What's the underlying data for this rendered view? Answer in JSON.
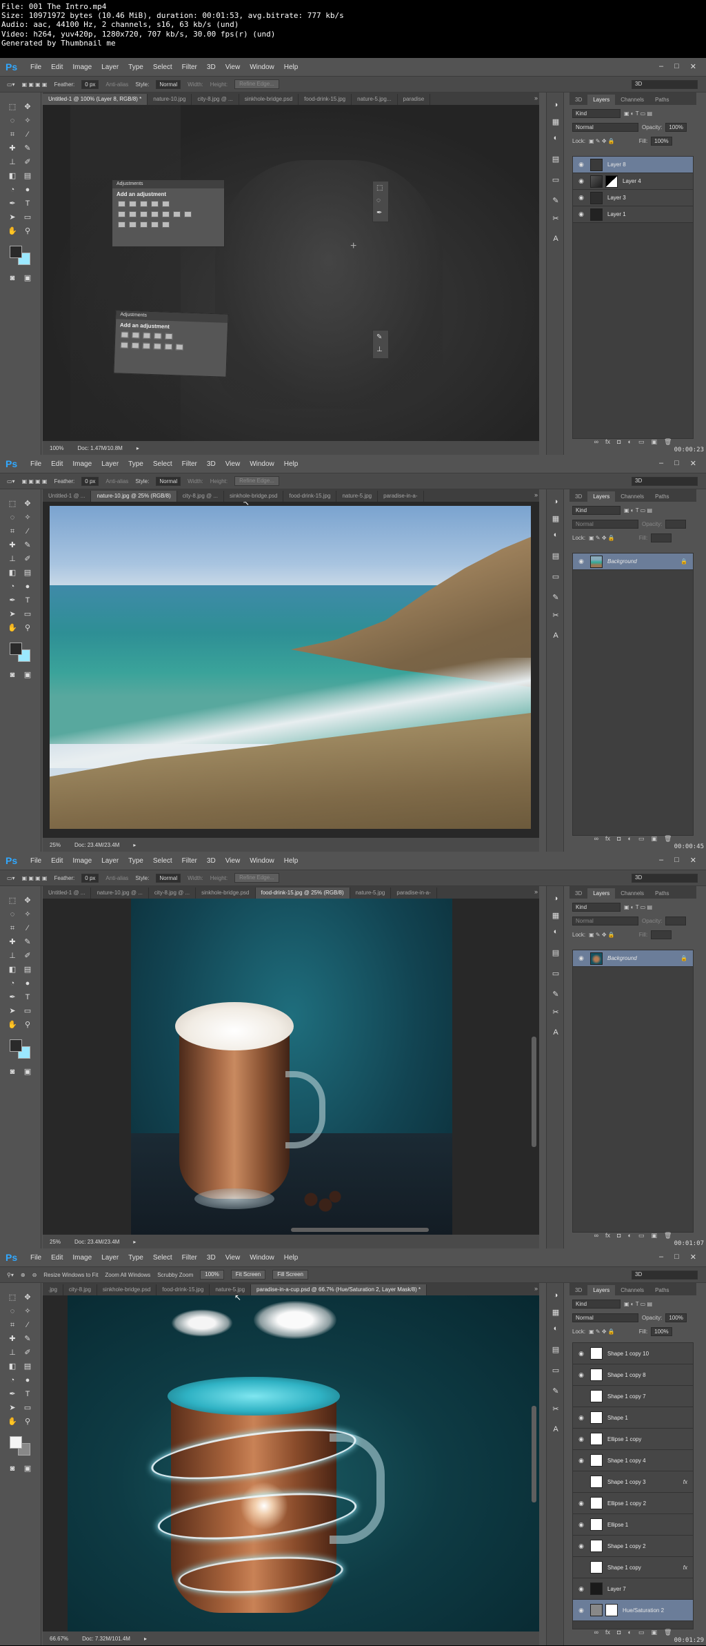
{
  "header": {
    "lines": [
      "File: 001 The Intro.mp4",
      "Size: 10971972 bytes (10.46 MiB), duration: 00:01:53, avg.bitrate: 777 kb/s",
      "Audio: aac, 44100 Hz, 2 channels, s16, 63 kb/s (und)",
      "Video: h264, yuv420p, 1280x720, 707 kb/s, 30.00 fps(r) (und)",
      "Generated by Thumbnail me"
    ]
  },
  "app": {
    "logo": "Ps",
    "menu": [
      "File",
      "Edit",
      "Image",
      "Layer",
      "Type",
      "Select",
      "Filter",
      "3D",
      "View",
      "Window",
      "Help"
    ],
    "window_controls": [
      "–",
      "□",
      "✕"
    ]
  },
  "options_bar": {
    "feather_label": "Feather:",
    "feather_value": "0 px",
    "anti_alias": "Anti-alias",
    "style_label": "Style:",
    "style_value": "Normal",
    "width_label": "Width:",
    "height_label": "Height:",
    "refine": "Refine Edge...",
    "workspace": "3D"
  },
  "zoom_options": {
    "resize": "Resize Windows to Fit",
    "zoom_all": "Zoom All Windows",
    "scrubby": "Scrubby Zoom",
    "pct": "100%",
    "fit": "Fit Screen",
    "fill": "Fill Screen",
    "workspace": "3D"
  },
  "frames": [
    {
      "tabs": [
        "Untitled-1 @ 100% (Layer 8, RGB/8) *",
        "nature-10.jpg",
        "city-8.jpg @ ...",
        "sinkhole-bridge.psd",
        "food-drink-15.jpg",
        "nature-5.jpg...",
        "paradise"
      ],
      "active_tab": 0,
      "status_zoom": "100%",
      "status_doc": "Doc: 1.47M/10.8M",
      "timestamp": "00:00:23",
      "adjustments": {
        "head": "Adjustments",
        "title": "Add an adjustment"
      },
      "layers_panel": {
        "tabs": [
          "3D",
          "Layers",
          "Channels",
          "Paths"
        ],
        "kind": "Kind",
        "blend": "Normal",
        "opacity_label": "Opacity:",
        "opacity": "100%",
        "lock_label": "Lock:",
        "fill_label": "Fill:",
        "fill": "100%",
        "layers": [
          {
            "name": "Layer 8",
            "selected": true
          },
          {
            "name": "Layer 4",
            "selected": false
          },
          {
            "name": "Layer 3",
            "selected": false
          },
          {
            "name": "Layer 1",
            "selected": false
          }
        ]
      }
    },
    {
      "tabs": [
        "Untitled-1 @ ...",
        "nature-10.jpg @ 25% (RGB/8)",
        "city-8.jpg @ ...",
        "sinkhole-bridge.psd",
        "food-drink-15.jpg",
        "nature-5.jpg",
        "paradise-in-a-"
      ],
      "active_tab": 1,
      "status_zoom": "25%",
      "status_doc": "Doc: 23.4M/23.4M",
      "timestamp": "00:00:45",
      "layers_panel": {
        "tabs": [
          "3D",
          "Layers",
          "Channels",
          "Paths"
        ],
        "kind": "Kind",
        "blend": "Normal",
        "opacity_label": "Opacity:",
        "lock_label": "Lock:",
        "fill_label": "Fill:",
        "layers": [
          {
            "name": "Background",
            "selected": true
          }
        ]
      }
    },
    {
      "tabs": [
        "Untitled-1 @ ...",
        "nature-10.jpg @ ...",
        "city-8.jpg @ ...",
        "sinkhole-bridge.psd",
        "food-drink-15.jpg @ 25% (RGB/8)",
        "nature-5.jpg",
        "paradise-in-a-"
      ],
      "active_tab": 4,
      "status_zoom": "25%",
      "status_doc": "Doc: 23.4M/23.4M",
      "timestamp": "00:01:07",
      "layers_panel": {
        "tabs": [
          "3D",
          "Layers",
          "Channels",
          "Paths"
        ],
        "kind": "Kind",
        "blend": "Normal",
        "opacity_label": "Opacity:",
        "lock_label": "Lock:",
        "fill_label": "Fill:",
        "layers": [
          {
            "name": "Background",
            "selected": true
          }
        ]
      }
    },
    {
      "tabs": [
        ".jpg",
        "city-8.jpg",
        "sinkhole-bridge.psd",
        "food-drink-15.jpg",
        "nature-5.jpg",
        "paradise-in-a-cup.psd @ 66.7% (Hue/Saturation 2, Layer Mask/8) *"
      ],
      "active_tab": 5,
      "status_zoom": "66.67%",
      "status_doc": "Doc: 7.32M/101.4M",
      "timestamp": "00:01:29",
      "layers_panel": {
        "tabs": [
          "3D",
          "Layers",
          "Channels",
          "Paths"
        ],
        "kind": "Kind",
        "blend": "Normal",
        "opacity_label": "Opacity:",
        "opacity": "100%",
        "lock_label": "Lock:",
        "fill_label": "Fill:",
        "fill": "100%",
        "layers": [
          {
            "name": "Shape 1 copy 10",
            "fx": false,
            "visible": true
          },
          {
            "name": "Shape 1 copy 8",
            "fx": false,
            "visible": true
          },
          {
            "name": "Shape 1 copy 7",
            "fx": false,
            "visible": false
          },
          {
            "name": "Shape 1",
            "fx": false,
            "visible": true
          },
          {
            "name": "Ellipse 1 copy",
            "fx": false,
            "visible": true
          },
          {
            "name": "Shape 1 copy 4",
            "fx": false,
            "visible": true
          },
          {
            "name": "Shape 1 copy 3",
            "fx": true,
            "visible": false
          },
          {
            "name": "Ellipse 1 copy 2",
            "fx": false,
            "visible": true
          },
          {
            "name": "Ellipse 1",
            "fx": false,
            "visible": true
          },
          {
            "name": "Shape 1 copy 2",
            "fx": false,
            "visible": true
          },
          {
            "name": "Shape 1 copy",
            "fx": true,
            "visible": false
          },
          {
            "name": "Layer 7",
            "fx": false,
            "visible": true
          },
          {
            "name": "Hue/Saturation 2",
            "fx": false,
            "visible": true,
            "selected": true
          }
        ]
      }
    }
  ],
  "colors": {
    "ui_bg": "#535353",
    "selected_layer": "#6b7d99",
    "ps_blue": "#31a8ff"
  }
}
